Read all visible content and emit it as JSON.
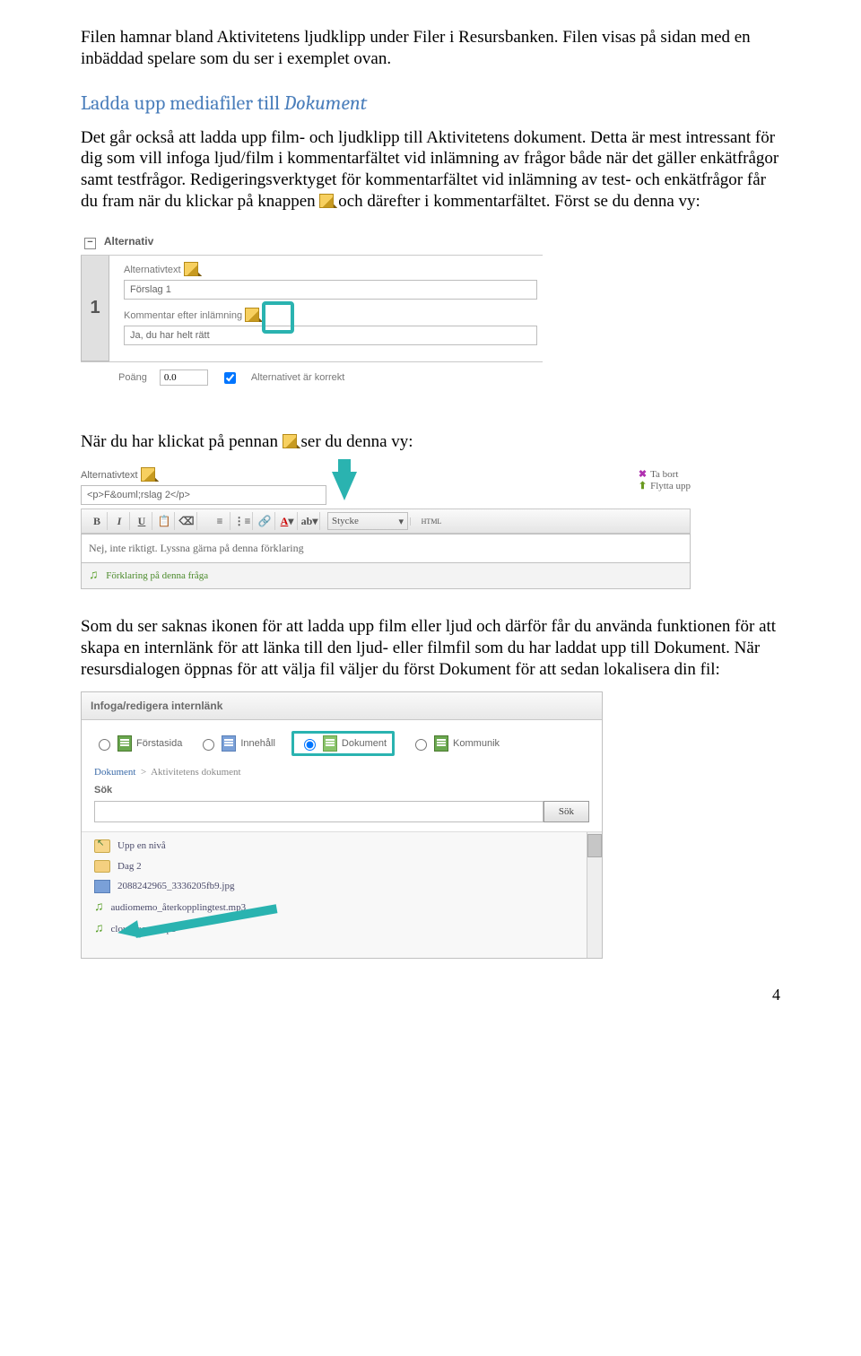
{
  "page_number": "4",
  "intro": {
    "p1": "Filen hamnar bland Aktivitetens ljudklipp under Filer i Resursbanken. Filen visas på sidan med en inbäddad spelare som du ser i exemplet ovan."
  },
  "heading": {
    "prefix": "Ladda upp mediafiler till ",
    "em": "Dokument"
  },
  "body": {
    "p2a": "Det går också att ladda upp film- och ljudklipp till Aktivitetens dokument. Detta är mest intressant för dig som vill infoga ljud/film i kommentarfältet vid inlämning av frågor både när det gäller enkätfrågor samt testfrågor. Redigeringsverktyget för kommentarfältet vid inlämning av test- och enkätfrågor får du fram när du klickar på knappen",
    "p2b": "och därefter i kommentarfältet. Först se du denna vy:",
    "p3a": "När du har klickat på pennan",
    "p3b": "ser du denna vy:",
    "p4": "Som du ser saknas ikonen för att ladda upp film eller ljud och därför får du använda funktionen för att skapa en internlänk för att länka till den ljud- eller filmfil som du har laddat upp till Dokument. När resursdialogen öppnas för att välja fil väljer du först Dokument för att sedan lokalisera din fil:"
  },
  "panel1": {
    "section": "Alternativ",
    "number": "1",
    "alt_label": "Alternativtext",
    "alt_value": "Förslag 1",
    "comment_label": "Kommentar efter inlämning",
    "comment_value": "Ja, du har helt rätt",
    "points_label": "Poäng",
    "points_value": "0.0",
    "correct_label": "Alternativet är korrekt"
  },
  "panel2": {
    "alt_label": "Alternativtext",
    "html_value": "<p>F&ouml;rslag 2</p>",
    "remove": "Ta bort",
    "moveup": "Flytta upp",
    "style": "Stycke",
    "html_btn": "HTML",
    "edit_text": "Nej, inte riktigt. Lyssna gärna på denna förklaring",
    "attachment": "Förklaring på denna fråga"
  },
  "panel3": {
    "title": "Infoga/redigera internlänk",
    "tabs": {
      "forstasida": "Förstasida",
      "innehall": "Innehåll",
      "dokument": "Dokument",
      "kommunik": "Kommunik"
    },
    "breadcrumb": {
      "root": "Dokument",
      "current": "Aktivitetens dokument"
    },
    "search_label": "Sök",
    "search_btn": "Sök",
    "files": {
      "up": "Upp en nivå",
      "folder": "Dag 2",
      "img": "2088242965_3336205fb9.jpg",
      "audio1": "audiomemo_återkopplingtest.mp3",
      "audio2": "cloud_song.mp3"
    }
  }
}
